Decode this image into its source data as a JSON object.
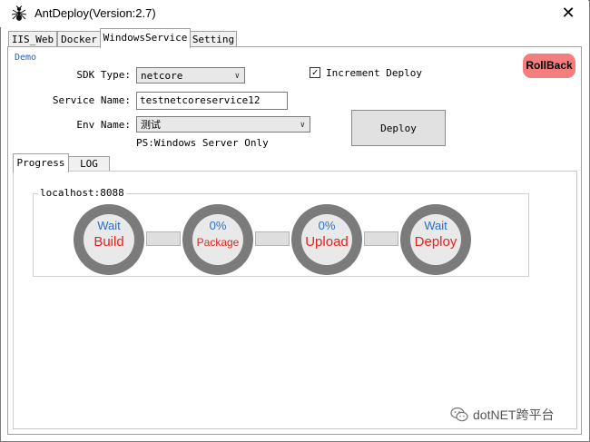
{
  "window": {
    "title": "AntDeploy(Version:2.7)",
    "close_glyph": "✕"
  },
  "tabs": [
    {
      "label": "IIS_Web"
    },
    {
      "label": "Docker"
    },
    {
      "label": "WindowsService",
      "active": true
    },
    {
      "label": "Setting"
    }
  ],
  "form": {
    "demo_label": "Demo",
    "sdk_type_label": "SDK Type:",
    "sdk_type_value": "netcore",
    "service_name_label": "Service Name:",
    "service_name_value": "testnetcoreservice12",
    "env_name_label": "Env Name:",
    "env_name_value": "测试",
    "ps_note": "PS:Windows Server Only",
    "increment_label": "Increment Deploy",
    "increment_checked": true,
    "check_glyph": "✓",
    "arrow_glyph": "∨"
  },
  "buttons": {
    "rollback": "RollBack",
    "deploy": "Deploy"
  },
  "inner_tabs": [
    {
      "label": "Progress",
      "active": true
    },
    {
      "label": "LOG"
    }
  ],
  "progress": {
    "host": "localhost:8088",
    "steps": [
      {
        "status": "Wait",
        "name": "Build"
      },
      {
        "status": "0%",
        "name": "Package"
      },
      {
        "status": "0%",
        "name": "Upload"
      },
      {
        "status": "Wait",
        "name": "Deploy"
      }
    ]
  },
  "watermark": "dotNET跨平台",
  "icons": {
    "app": "ant-icon",
    "watermark": "wechat-icon"
  },
  "colors": {
    "rollback_bg": "#f47e7e",
    "ring": "#7b7b7b",
    "status_text": "#2c6fc6",
    "step_text": "#e8231e",
    "demo_text": "#2060c0"
  }
}
